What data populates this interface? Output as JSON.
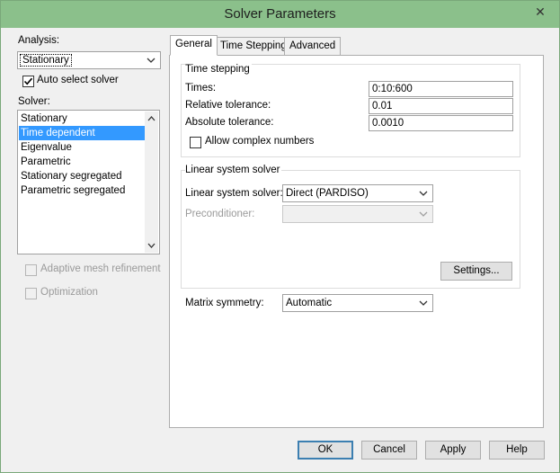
{
  "window": {
    "title": "Solver Parameters",
    "close_glyph": "✕"
  },
  "left": {
    "analysis_label": "Analysis:",
    "analysis_value": "Stationary",
    "auto_select_label": "Auto select solver",
    "auto_select_checked": true,
    "solver_label": "Solver:",
    "solver_items": [
      "Stationary",
      "Time dependent",
      "Eigenvalue",
      "Parametric",
      "Stationary segregated",
      "Parametric segregated"
    ],
    "solver_selected": "Time dependent",
    "adaptive_label": "Adaptive mesh refinement",
    "optimization_label": "Optimization"
  },
  "tabs": [
    "General",
    "Time Stepping",
    "Advanced"
  ],
  "active_tab": "General",
  "general": {
    "time_stepping_title": "Time stepping",
    "times_label": "Times:",
    "times_value": "0:10:600",
    "rel_tol_label": "Relative tolerance:",
    "rel_tol_value": "0.01",
    "abs_tol_label": "Absolute tolerance:",
    "abs_tol_value": "0.0010",
    "complex_label": "Allow complex numbers",
    "complex_checked": false,
    "linear_title": "Linear system solver",
    "linear_label": "Linear system solver:",
    "linear_value": "Direct (PARDISO)",
    "precond_label": "Preconditioner:",
    "precond_value": "",
    "settings_button": "Settings...",
    "matrix_label": "Matrix symmetry:",
    "matrix_value": "Automatic"
  },
  "buttons": {
    "ok": "OK",
    "cancel": "Cancel",
    "apply": "Apply",
    "help": "Help"
  },
  "icons": {
    "dropdown": "chevron-down-icon",
    "check": "check-icon",
    "scroll_up": "scroll-up-arrow-icon",
    "scroll_down": "scroll-down-arrow-icon"
  }
}
